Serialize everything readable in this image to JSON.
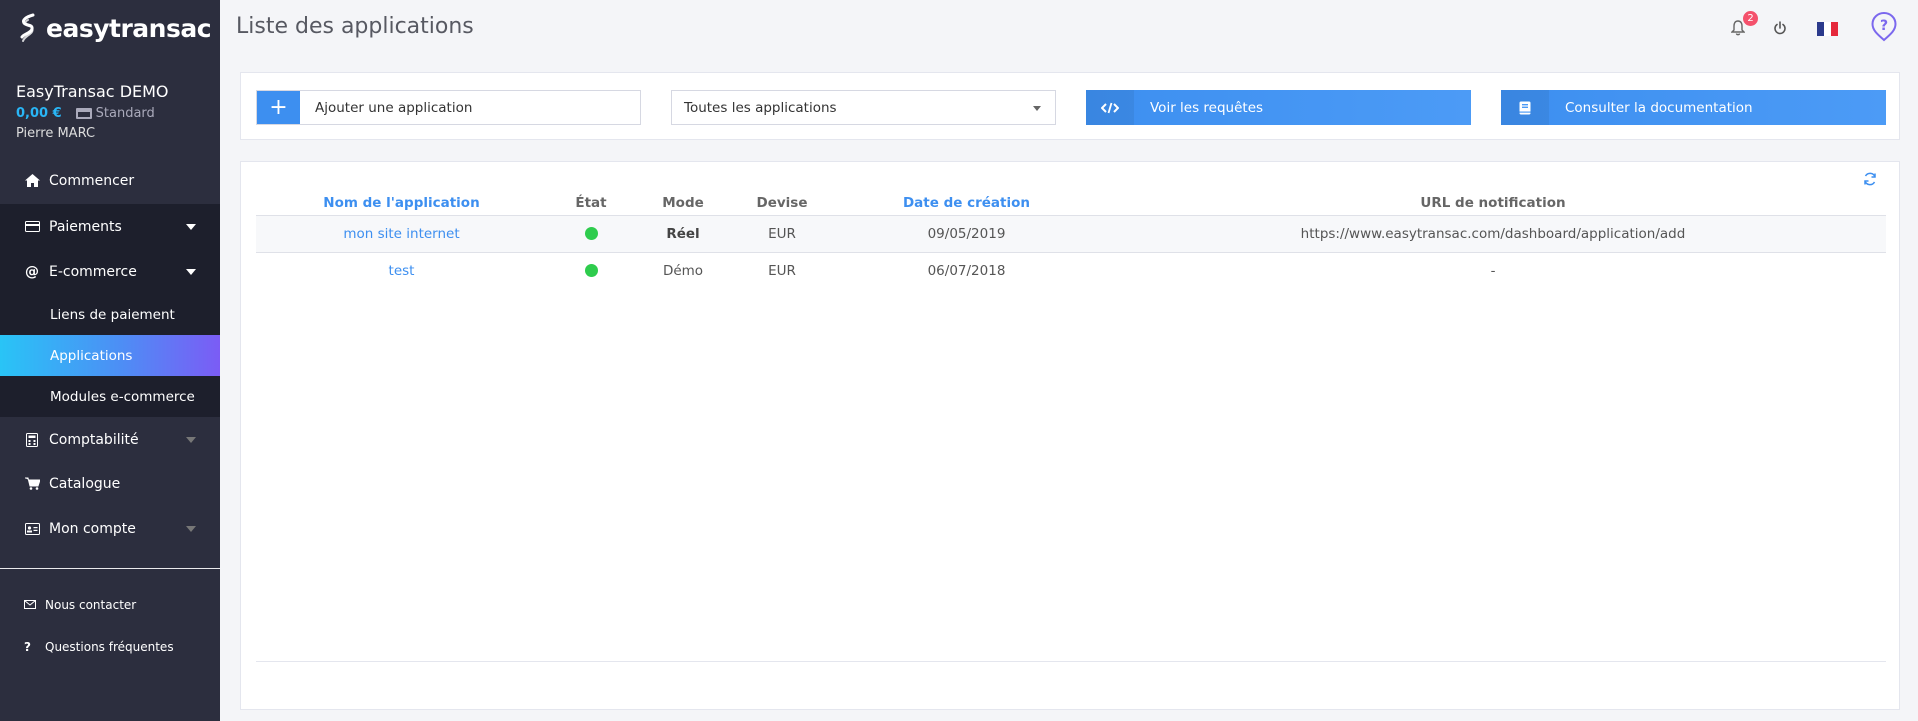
{
  "brand": {
    "name": "easytransac"
  },
  "account": {
    "name": "EasyTransac DEMO",
    "balance": "0,00 €",
    "plan": "Standard",
    "user": "Pierre MARC"
  },
  "nav": {
    "items": [
      {
        "label": "Commencer",
        "icon": "home-icon"
      },
      {
        "label": "Paiements",
        "icon": "card-icon"
      },
      {
        "label": "E-commerce",
        "icon": "at-icon"
      },
      {
        "label": "Comptabilité",
        "icon": "calculator-icon"
      },
      {
        "label": "Catalogue",
        "icon": "cart-icon"
      },
      {
        "label": "Mon compte",
        "icon": "id-card-icon"
      }
    ],
    "sub_items": [
      {
        "label": "Liens de paiement"
      },
      {
        "label": "Applications"
      },
      {
        "label": "Modules e-commerce"
      }
    ],
    "footer": [
      {
        "label": "Nous contacter",
        "icon": "envelope-icon"
      },
      {
        "label": "Questions fréquentes",
        "icon": "question-icon"
      }
    ]
  },
  "header": {
    "title": "Liste des applications",
    "notification_count": "2"
  },
  "toolbar": {
    "add_label": "Ajouter une application",
    "add_symbol": "+",
    "filter_value": "Toutes les applications",
    "requests_label": "Voir les requêtes",
    "docs_label": "Consulter la documentation"
  },
  "table": {
    "headers": [
      "Nom de l'application",
      "État",
      "Mode",
      "Devise",
      "Date de création",
      "URL de notification"
    ],
    "rows": [
      {
        "name": "mon site internet",
        "state": "active",
        "mode": "Réel",
        "currency": "EUR",
        "date": "09/05/2019",
        "url": "https://www.easytransac.com/dashboard/application/add"
      },
      {
        "name": "test",
        "state": "active",
        "mode": "Démo",
        "currency": "EUR",
        "date": "06/07/2018",
        "url": "-"
      }
    ]
  },
  "colors": {
    "accent": "#3d8ff0",
    "sidebar": "#2c2e3e",
    "status_active": "#2ecc4d",
    "badge": "#f4516c"
  }
}
